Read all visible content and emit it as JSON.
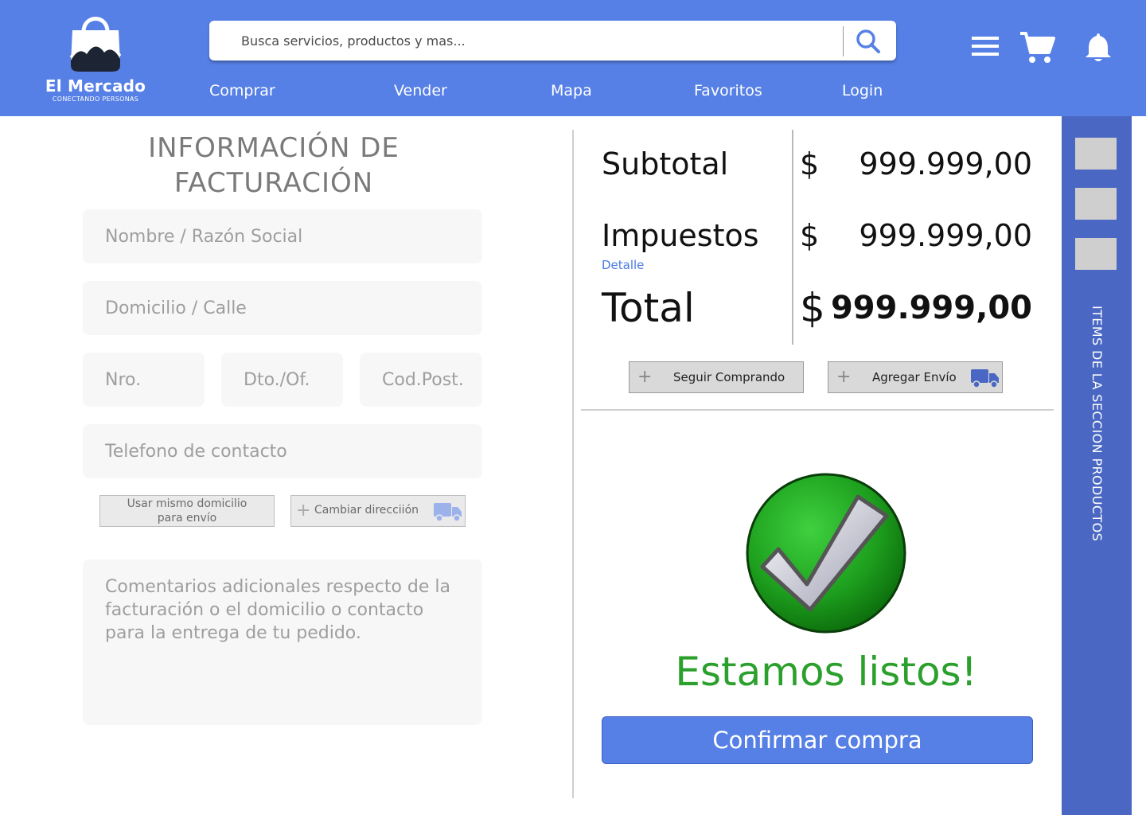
{
  "header": {
    "brand_name": "El Mercado",
    "brand_tagline": "CONECTANDO PERSONAS",
    "search_placeholder": "Busca servicios, productos y mas...",
    "nav": [
      "Comprar",
      "Vender",
      "Mapa",
      "Favoritos",
      "Login"
    ],
    "icons": [
      "menu-icon",
      "cart-icon",
      "bell-icon",
      "search-icon"
    ],
    "accent_color": "#5680E6"
  },
  "billing": {
    "title_line1": "INFORMACIÓN DE",
    "title_line2": "FACTURACIÓN",
    "name_placeholder": "Nombre / Razón Social",
    "address_placeholder": "Domicilio / Calle",
    "number_placeholder": "Nro.",
    "apt_placeholder": "Dto./Of.",
    "zip_placeholder": "Cod.Post.",
    "phone_placeholder": "Telefono de contacto",
    "same_address_button": "Usar mismo domicilio para envío",
    "change_address_button": "Cambiar direcciión",
    "comments_placeholder": "Comentarios adicionales respecto de la facturación o el domicilio o contacto para la entrega de tu pedido."
  },
  "summary": {
    "subtotal_label": "Subtotal",
    "subtotal_currency": "$",
    "subtotal_value": "999.999,00",
    "taxes_label": "Impuestos",
    "taxes_currency": "$",
    "taxes_value": "999.999,00",
    "taxes_detail_link": "Detalle",
    "total_label": "Total",
    "total_currency": "$",
    "total_value": "999.999,00",
    "continue_shopping_button": "Seguir Comprando",
    "add_shipping_button": "Agregar Envío"
  },
  "confirmation": {
    "ready_text": "Estamos listos!",
    "confirm_button": "Confirmar compra",
    "success_color": "#2CA02C"
  },
  "sidebar": {
    "label": "ITEMS DE LA SECCION PRODUCTOS",
    "thumbnail_count": 3,
    "color": "#4A68C3"
  }
}
